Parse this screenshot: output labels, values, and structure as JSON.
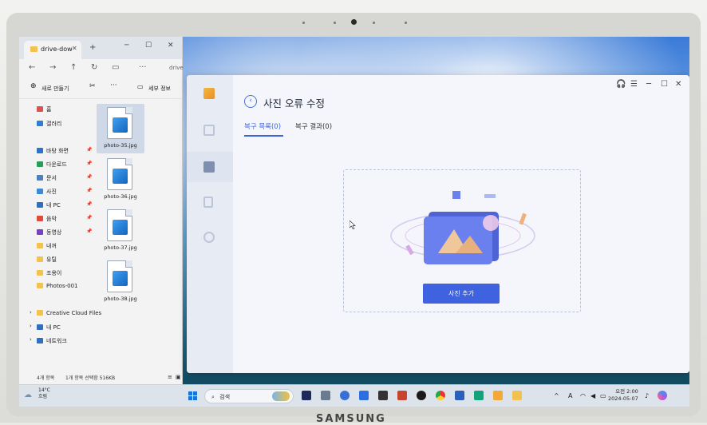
{
  "device": {
    "brand": "SAMSUNG"
  },
  "explorer": {
    "tab_title": "drive-dow",
    "address_fragment": "drive",
    "new_label": "새로 만들기",
    "details_label": "세부 정보",
    "sidebar": [
      {
        "label": "홈",
        "icon": "home-icon",
        "color": "#d9534f"
      },
      {
        "label": "갤러리",
        "icon": "gallery-icon",
        "color": "#2d7fd6"
      },
      {
        "label": "바탕 화면",
        "icon": "desktop-icon",
        "color": "#2b74c9",
        "pinned": true
      },
      {
        "label": "다운로드",
        "icon": "download-icon",
        "color": "#2a9d5a",
        "pinned": true
      },
      {
        "label": "문서",
        "icon": "documents-icon",
        "color": "#4a7ec7",
        "pinned": true
      },
      {
        "label": "사진",
        "icon": "pictures-icon",
        "color": "#3a8ad8",
        "pinned": true
      },
      {
        "label": "내 PC",
        "icon": "pc-icon",
        "color": "#2f6fc2",
        "pinned": true
      },
      {
        "label": "음악",
        "icon": "music-icon",
        "color": "#e04a3a",
        "pinned": true
      },
      {
        "label": "동영상",
        "icon": "video-icon",
        "color": "#7a3fc4",
        "pinned": true
      },
      {
        "label": "내꺼",
        "icon": "folder-icon",
        "color": "#f2c14e"
      },
      {
        "label": "유틸",
        "icon": "folder-icon",
        "color": "#f2c14e"
      },
      {
        "label": "조용이",
        "icon": "folder-icon",
        "color": "#f2c14e"
      },
      {
        "label": "Photos-001",
        "icon": "folder-icon",
        "color": "#f2c14e"
      },
      {
        "label": "Creative Cloud Files",
        "icon": "folder-icon",
        "color": "#f2c14e"
      },
      {
        "label": "내 PC",
        "icon": "pc-icon",
        "color": "#2f6fc2"
      },
      {
        "label": "네트워크",
        "icon": "network-icon",
        "color": "#2f6fc2"
      }
    ],
    "files": [
      "photo-35.jpg",
      "photo-36.jpg",
      "photo-37.jpg",
      "photo-38.jpg"
    ],
    "status_count": "4개 항목",
    "status_selected": "1개 항목 선택함 516KB"
  },
  "app": {
    "title": "사진 오류 수정",
    "tab_recovery_list": "복구 목록(0)",
    "tab_recovery_result": "복구 결과(0)",
    "add_photo_button": "사진 추가",
    "accent": "#3f62e0"
  },
  "taskbar": {
    "weather_temp": "14°C",
    "weather_desc": "흐림",
    "search_placeholder": "검색",
    "tray_lang": "A",
    "time": "오전 2:00",
    "date": "2024-05-07"
  }
}
